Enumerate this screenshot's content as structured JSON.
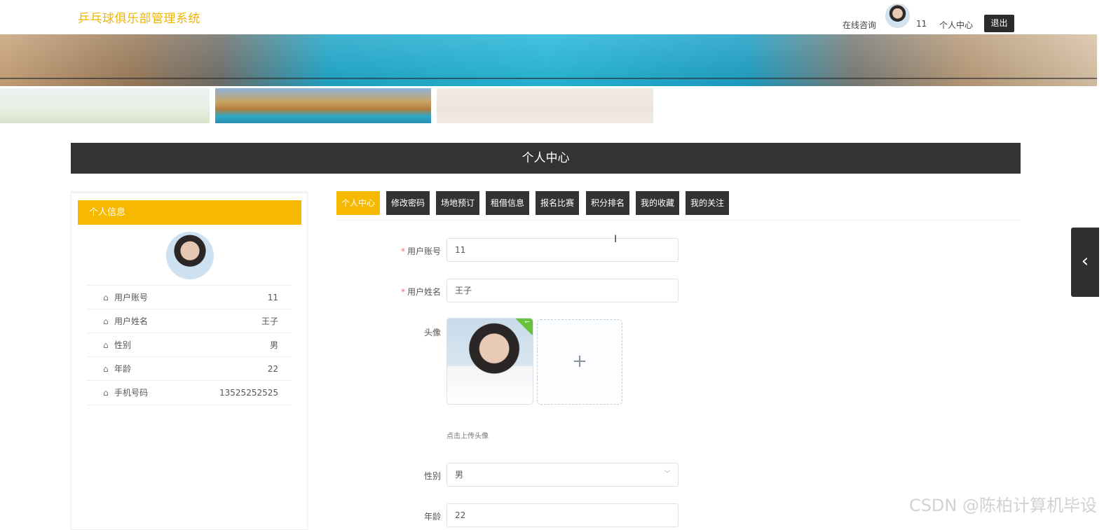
{
  "header": {
    "brand": "乒乓球俱乐部管理系统",
    "nav": {
      "online_consult": "在线咨询",
      "username": "11",
      "profile_center": "个人中心",
      "logout": "退出"
    }
  },
  "section_title": "个人中心",
  "left_card": {
    "title": "个人信息",
    "rows": [
      {
        "label": "用户账号",
        "value": "11"
      },
      {
        "label": "用户姓名",
        "value": "王子"
      },
      {
        "label": "性别",
        "value": "男"
      },
      {
        "label": "年龄",
        "value": "22"
      },
      {
        "label": "手机号码",
        "value": "13525252525"
      }
    ]
  },
  "tabs": [
    {
      "label": "个人中心",
      "active": true
    },
    {
      "label": "修改密码",
      "active": false
    },
    {
      "label": "场地预订",
      "active": false
    },
    {
      "label": "租借信息",
      "active": false
    },
    {
      "label": "报名比赛",
      "active": false
    },
    {
      "label": "积分排名",
      "active": false
    },
    {
      "label": "我的收藏",
      "active": false
    },
    {
      "label": "我的关注",
      "active": false
    }
  ],
  "form": {
    "account": {
      "label": "用户账号",
      "value": "11",
      "required": "*"
    },
    "name": {
      "label": "用户姓名",
      "value": "王子",
      "required": "*"
    },
    "avatar": {
      "label": "头像",
      "upload_plus": "+",
      "tip": "点击上传头像",
      "check": "✓"
    },
    "gender": {
      "label": "性别",
      "value": "男"
    },
    "age": {
      "label": "年龄",
      "value": "22"
    }
  },
  "side_handle_icon": "‹",
  "watermark": "CSDN @陈柏计算机毕设",
  "colors": {
    "accent": "#f7b800",
    "dark": "#333333",
    "required": "#f56c6c"
  }
}
